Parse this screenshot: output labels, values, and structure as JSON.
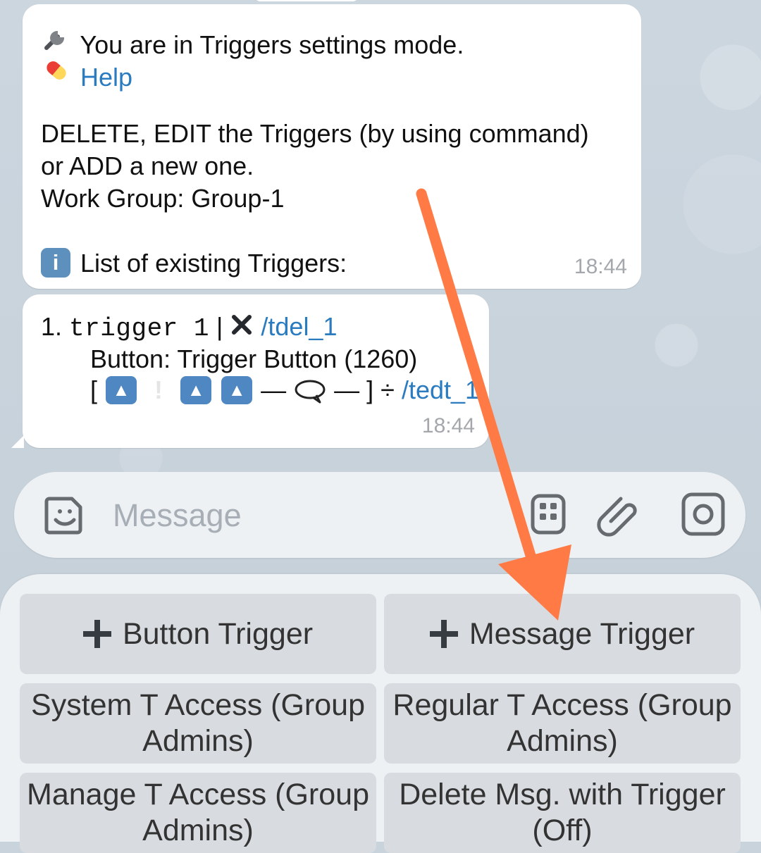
{
  "chat": {
    "message1": {
      "line1": "You are in Triggers settings mode.",
      "help": "Help",
      "line3": "DELETE, EDIT the Triggers (by using command)",
      "line4": "or ADD a new one.",
      "line5": "Work Group: Group-1",
      "line6": "List of existing Triggers:",
      "time": "18:44",
      "icons": {
        "tool": "wrench-icon",
        "help": "pill-icon",
        "info": "info-icon"
      }
    },
    "message2": {
      "number": "1.",
      "trigger_name": "trigger 1",
      "separator": "|",
      "delete_command": "/tdel_1",
      "button_line": "Button: Trigger Button (1260)",
      "edit_command": "/tedt_1",
      "time": "18:44",
      "icons": {
        "delete": "cross-icon",
        "edit": "divide-icon"
      }
    }
  },
  "input": {
    "placeholder": "Message",
    "icons": [
      "sticker-icon",
      "keyboard-icon",
      "attach-icon",
      "camera-icon"
    ]
  },
  "keyboard": {
    "buttons": [
      "Button Trigger",
      "Message Trigger",
      "System T Access (Group Admins)",
      "Regular T Access (Group Admins)",
      "Manage T Access (Group Admins)",
      "Delete Msg. with Trigger (Off)"
    ]
  },
  "annotation": {
    "color": "#ff7a45"
  }
}
